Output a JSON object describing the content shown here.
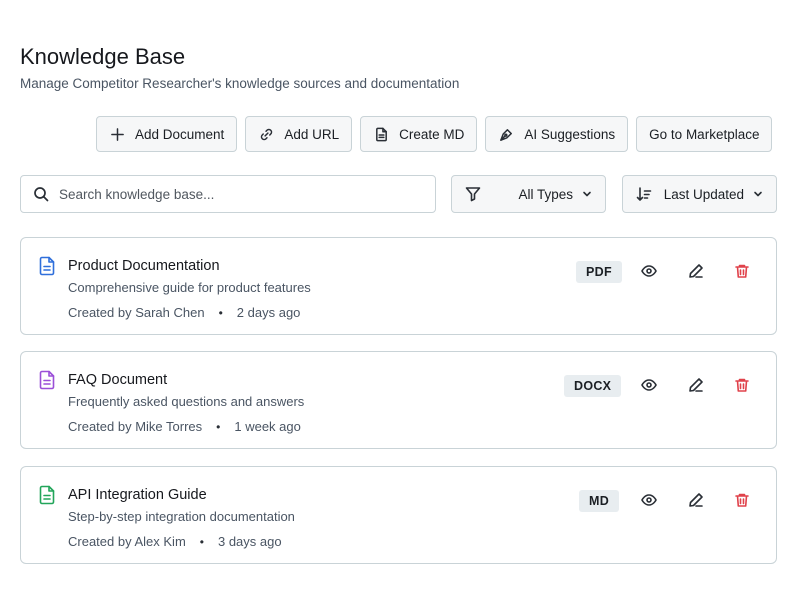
{
  "header": {
    "title": "Knowledge Base",
    "subtitle": "Manage Competitor Researcher's knowledge sources and documentation"
  },
  "toolbar": {
    "add_document": "Add Document",
    "add_url": "Add URL",
    "create_md": "Create MD",
    "ai_suggestions": "AI Suggestions",
    "marketplace": "Go to Marketplace"
  },
  "search": {
    "placeholder": "Search knowledge base..."
  },
  "filters": {
    "type": "All Types",
    "sort": "Last Updated"
  },
  "documents": [
    {
      "title": "Product Documentation",
      "description": "Comprehensive guide for product features",
      "author": "Created by Sarah Chen",
      "time": "2 days ago",
      "type": "PDF",
      "icon_color": "#2f6fdb"
    },
    {
      "title": "FAQ Document",
      "description": "Frequently asked questions and answers",
      "author": "Created by Mike Torres",
      "time": "1 week ago",
      "type": "DOCX",
      "icon_color": "#9b4fd8"
    },
    {
      "title": "API Integration Guide",
      "description": "Step-by-step integration documentation",
      "author": "Created by Alex Kim",
      "time": "3 days ago",
      "type": "MD",
      "icon_color": "#22a55a"
    }
  ],
  "colors": {
    "delete": "#e0424b",
    "border": "#c9d3d7",
    "badge_bg": "#e8edf0"
  }
}
